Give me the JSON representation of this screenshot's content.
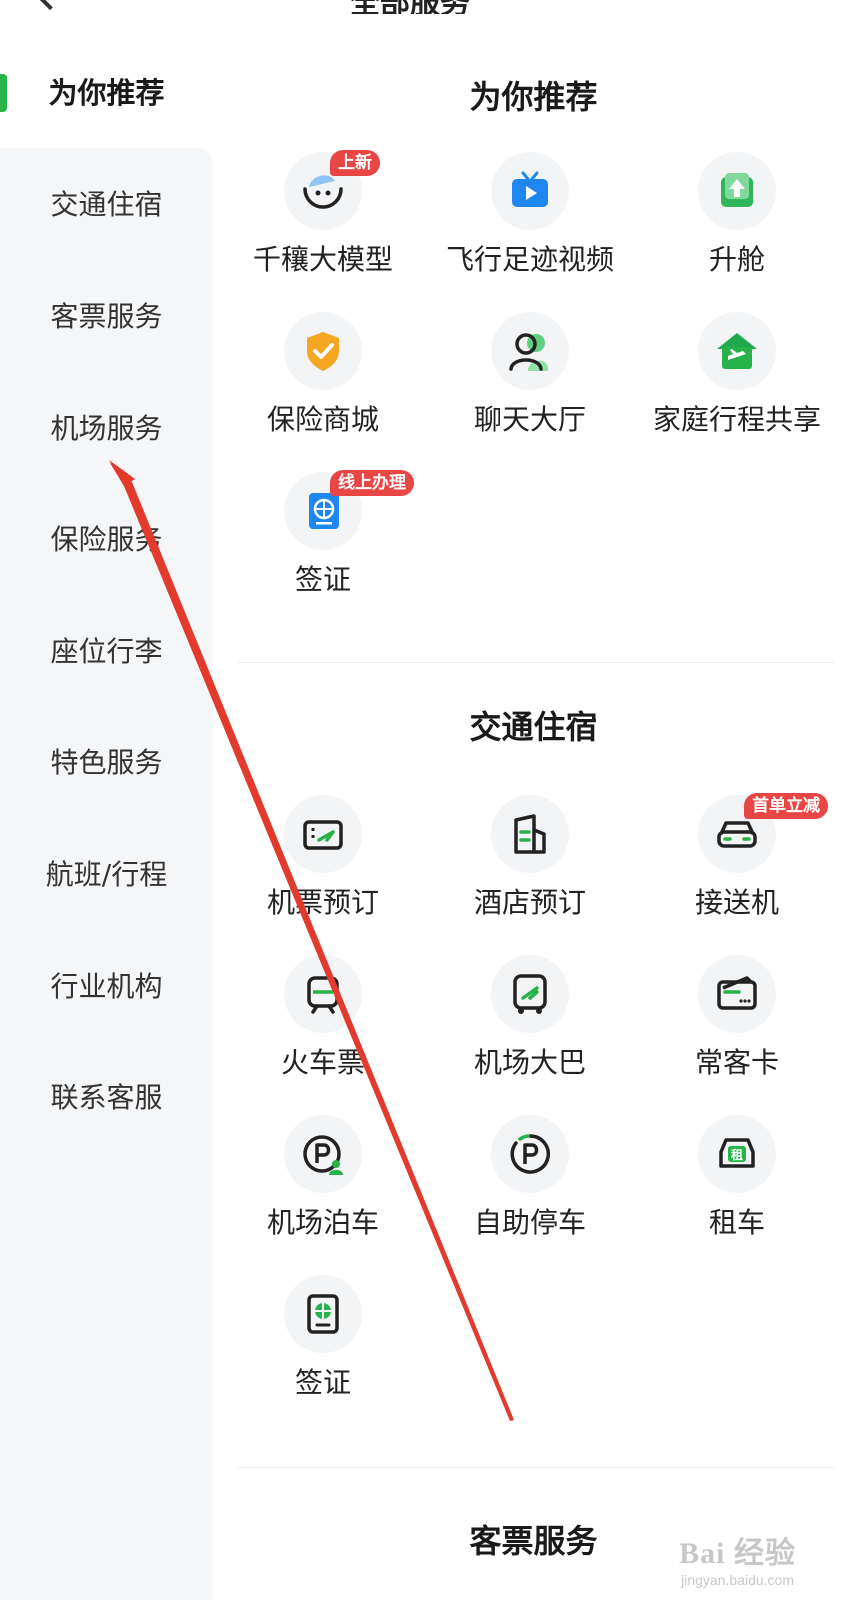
{
  "header": {
    "back_icon": "back-arrow-icon",
    "title_partial": "全部服务"
  },
  "sidebar": {
    "accent_color": "#27b24a",
    "items": [
      {
        "label": "为你推荐",
        "active": true
      },
      {
        "label": "交通住宿"
      },
      {
        "label": "客票服务"
      },
      {
        "label": "机场服务"
      },
      {
        "label": "保险服务"
      },
      {
        "label": "座位行李"
      },
      {
        "label": "特色服务"
      },
      {
        "label": "航班/行程"
      },
      {
        "label": "行业机构"
      },
      {
        "label": "联系客服"
      }
    ]
  },
  "sections": {
    "recommend": {
      "title": "为你推荐",
      "items": [
        {
          "label": "千穰大模型",
          "icon": "ai-face-icon",
          "badge": "上新"
        },
        {
          "label": "飞行足迹视频",
          "icon": "tv-play-icon"
        },
        {
          "label": "升舱",
          "icon": "upgrade-icon"
        },
        {
          "label": "保险商城",
          "icon": "shield-check-icon"
        },
        {
          "label": "聊天大厅",
          "icon": "chat-people-icon"
        },
        {
          "label": "家庭行程共享",
          "icon": "house-plane-icon"
        },
        {
          "label": "签证",
          "icon": "passport-globe-icon",
          "badge": "线上办理"
        }
      ]
    },
    "transport": {
      "title": "交通住宿",
      "items": [
        {
          "label": "机票预订",
          "icon": "ticket-plane-icon"
        },
        {
          "label": "酒店预订",
          "icon": "hotel-building-icon"
        },
        {
          "label": "接送机",
          "icon": "car-icon",
          "badge": "首单立减"
        },
        {
          "label": "火车票",
          "icon": "train-icon"
        },
        {
          "label": "机场大巴",
          "icon": "bus-icon"
        },
        {
          "label": "常客卡",
          "icon": "member-card-icon"
        },
        {
          "label": "机场泊车",
          "icon": "parking-person-icon"
        },
        {
          "label": "自助停车",
          "icon": "self-parking-icon"
        },
        {
          "label": "租车",
          "icon": "rent-car-icon"
        },
        {
          "label": "签证",
          "icon": "passport-icon"
        }
      ]
    },
    "ticket": {
      "title": "客票服务"
    }
  },
  "watermark": {
    "main": "Bai 经验",
    "sub": "jingyan.baidu.com"
  }
}
